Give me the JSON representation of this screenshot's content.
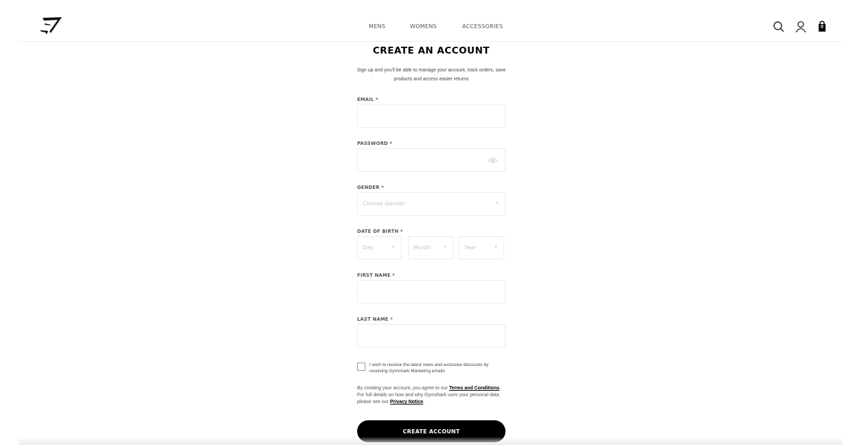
{
  "header": {
    "nav": [
      {
        "label": "MENS"
      },
      {
        "label": "WOMENS"
      },
      {
        "label": "ACCESSORIES"
      }
    ],
    "icons": {
      "search": "search-icon",
      "account": "user-icon",
      "bag": "shopping-bag-icon"
    },
    "bag_count": "0"
  },
  "form": {
    "title": "CREATE AN ACCOUNT",
    "subtitle": "Sign up and you'll be able to manage your account, track orders, save products and access easier returns",
    "email": {
      "label": "EMAIL *",
      "value": ""
    },
    "password": {
      "label": "PASSWORD *",
      "value": ""
    },
    "gender": {
      "label": "GENDER *",
      "placeholder": "Choose Gender"
    },
    "dob": {
      "label": "DATE OF BIRTH *",
      "day": "Day",
      "month": "Month",
      "year": "Year"
    },
    "first_name": {
      "label": "FIRST NAME *",
      "value": ""
    },
    "last_name": {
      "label": "LAST NAME *",
      "value": ""
    },
    "marketing": {
      "label": "I wish to receive the latest news and exclusive discounts by receiving Gymshark Marketing emails",
      "checked": false
    },
    "terms": {
      "prefix": "By creating your account, you agree to our ",
      "terms_link": "Terms and Conditions",
      "middle": ". For full details on how and why Gymshark uses your personal data please see our ",
      "privacy_link": "Privacy Notice",
      "suffix": "."
    },
    "submit_label": "CREATE ACCOUNT"
  }
}
